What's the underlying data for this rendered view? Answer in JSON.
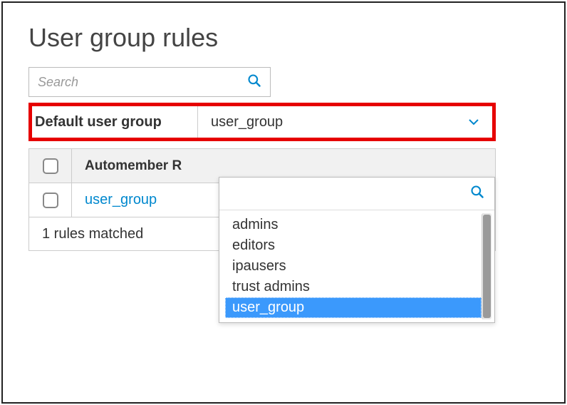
{
  "page_title": "User group rules",
  "search": {
    "placeholder": "Search"
  },
  "default_group": {
    "label": "Default user group",
    "selected": "user_group"
  },
  "table": {
    "column_header": "Automember R",
    "rows": [
      {
        "name": "user_group"
      }
    ],
    "footer": "1 rules matched"
  },
  "dropdown": {
    "options": [
      "admins",
      "editors",
      "ipausers",
      "trust admins",
      "user_group"
    ],
    "selected_index": 4
  }
}
